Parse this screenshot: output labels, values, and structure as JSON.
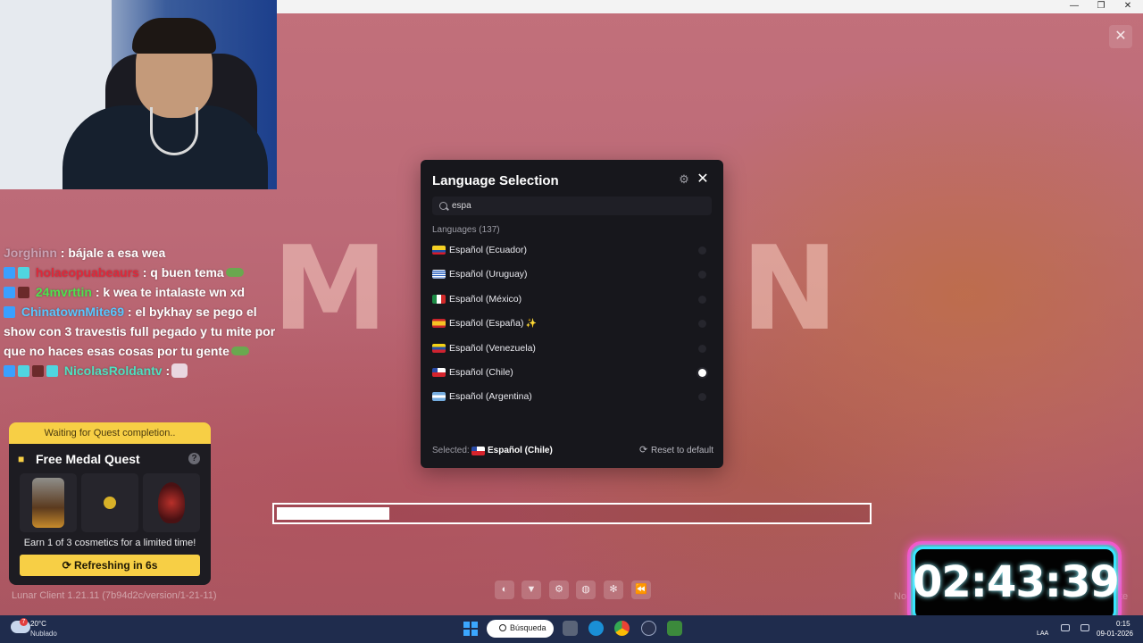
{
  "window": {
    "minimize": "—",
    "maximize": "❐",
    "close": "✕"
  },
  "app": {
    "close_icon": "✕",
    "logo_text": "MOJANG",
    "version": "Lunar Client 1.21.11 (7b94d2c/version/1-21-11)",
    "progress_fraction": 0.19
  },
  "chat": {
    "lines": [
      {
        "user": "Jorghinn",
        "user_color": "#c9a0b2",
        "message": ": bájale a esa wea"
      },
      {
        "user": "holaeopuabeaurs",
        "user_color": "#e0283a",
        "message": ": q buen tema"
      },
      {
        "user": "24mvrttin",
        "user_color": "#4ee24e",
        "message": ": k wea te intalaste wn xd"
      },
      {
        "user": "ChinatownMite69",
        "user_color": "#57c7ff",
        "message": ": el bykhay se pego el show con 3 travestis full pegado y tu mite por que no haces esas cosas por tu gente"
      },
      {
        "user": "NicolasRoldantv",
        "user_color": "#4fe0c0",
        "message": ":"
      }
    ]
  },
  "quest": {
    "status": "Waiting for Quest completion..",
    "title": "Free Medal Quest",
    "help_icon": "?",
    "gift_icon": "gift-icon",
    "items": [
      "armor-cosmetic",
      "ring-cosmetic",
      "wings-cosmetic"
    ],
    "description": "Earn 1 of 3 cosmetics for a limited time!",
    "button_icon": "⟳",
    "button_label": "Refreshing in 6s"
  },
  "language_modal": {
    "title": "Language Selection",
    "settings_icon": "⚙",
    "close_icon": "✕",
    "search_value": "espa",
    "count_label": "Languages (137)",
    "languages": [
      {
        "label": "Español (Ecuador)",
        "flag": "ec",
        "selected": false,
        "highlight": false
      },
      {
        "label": "Español (Uruguay)",
        "flag": "uy",
        "selected": false,
        "highlight": false
      },
      {
        "label": "Español (México)",
        "flag": "mx",
        "selected": false,
        "highlight": false
      },
      {
        "label": "Español (España)",
        "flag": "es",
        "selected": false,
        "highlight": true
      },
      {
        "label": "Español (Venezuela)",
        "flag": "ve",
        "selected": false,
        "highlight": false
      },
      {
        "label": "Español (Chile)",
        "flag": "cl",
        "selected": true,
        "highlight": false
      },
      {
        "label": "Español (Argentina)",
        "flag": "ar",
        "selected": false,
        "highlight": false
      }
    ],
    "sparkle": "✨",
    "selected_label": "Selected:",
    "selected_value": "Español (Chile)",
    "reset_icon": "⟳",
    "reset_label": "Reset to default"
  },
  "toolbar": {
    "buttons": [
      {
        "name": "cosmetics-icon",
        "glyph": "◐"
      },
      {
        "name": "wardrobe-icon",
        "glyph": "▼"
      },
      {
        "name": "settings-icon",
        "glyph": "⚙"
      },
      {
        "name": "globe-icon",
        "glyph": "◍"
      },
      {
        "name": "gear-alt-icon",
        "glyph": "✻"
      },
      {
        "name": "rewind-icon",
        "glyph": "⏪"
      }
    ]
  },
  "overlay": {
    "timer": "02:43:39",
    "affiliate_left": "No",
    "affiliate_right": "te"
  },
  "taskbar": {
    "weather_alert": "7",
    "weather_temp": "20°C",
    "weather_desc": "Nublado",
    "search_label": "Búsqueda",
    "tray_lang": "LAA",
    "time": "0:15",
    "date": "09-01-2026"
  }
}
